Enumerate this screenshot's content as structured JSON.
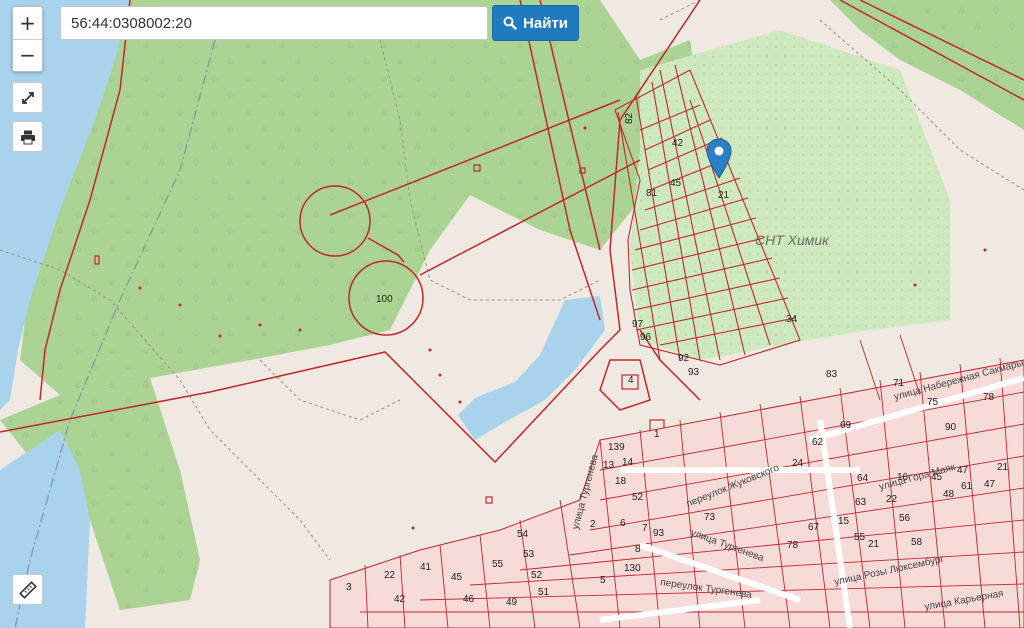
{
  "search": {
    "value": "56:44:0308002:20",
    "button_label": "Найти"
  },
  "controls": {
    "zoom_in_label": "+",
    "zoom_out_label": "−"
  },
  "map": {
    "area_label": "СНТ Химик",
    "parcel_labels": [
      "100",
      "82",
      "42",
      "45",
      "81",
      "21",
      "97",
      "96",
      "92",
      "93",
      "4",
      "34",
      "1",
      "139",
      "13",
      "14",
      "18",
      "52",
      "54",
      "55",
      "53",
      "52",
      "51",
      "46",
      "45",
      "47",
      "48",
      "21",
      "24",
      "22",
      "42",
      "41",
      "49",
      "3",
      "2",
      "6",
      "7",
      "8",
      "93",
      "73",
      "78",
      "71",
      "67",
      "64",
      "83",
      "78",
      "69",
      "63",
      "62",
      "58",
      "61",
      "55",
      "56",
      "45",
      "47",
      "21",
      "15",
      "22",
      "16",
      "75",
      "90",
      "130",
      "5"
    ],
    "street_labels": [
      "улица Набережная Сакмары",
      "улица Тургенева",
      "переулок Тургенева",
      "переулок Жуковского",
      "улица Гора Маяк",
      "улица Карьерная",
      "улица Розы Люксембург",
      "улица Тургенева"
    ]
  },
  "colors": {
    "forest": "#a9d394",
    "garden": "#cfe9bf",
    "water": "#a9d3ec",
    "land": "#efe9e1",
    "parcel_line": "#c3262c",
    "button": "#1f7ac0",
    "marker": "#2b7fc4"
  },
  "icons": [
    "zoom-in-icon",
    "zoom-out-icon",
    "fullscreen-icon",
    "print-icon",
    "search-icon",
    "ruler-icon",
    "location-marker-icon"
  ]
}
